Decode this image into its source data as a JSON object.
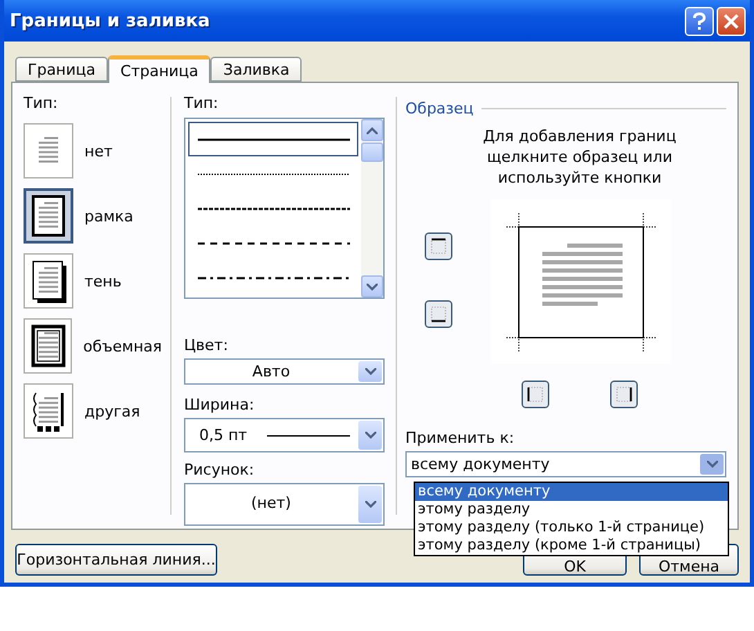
{
  "window": {
    "title": "Границы и заливка"
  },
  "tabs": [
    {
      "label": "Граница",
      "selected": false
    },
    {
      "label": "Страница",
      "selected": true
    },
    {
      "label": "Заливка",
      "selected": false
    }
  ],
  "setting": {
    "label": "Тип:",
    "options": [
      {
        "label": "нет",
        "kind": "none",
        "selected": false
      },
      {
        "label": "рамка",
        "kind": "box",
        "selected": true
      },
      {
        "label": "тень",
        "kind": "shadow",
        "selected": false
      },
      {
        "label": "объемная",
        "kind": "double",
        "selected": false
      },
      {
        "label": "другая",
        "kind": "custom",
        "selected": false
      }
    ]
  },
  "style": {
    "label": "Тип:",
    "lines": [
      {
        "kind": "solid",
        "selected": true
      },
      {
        "kind": "dotted",
        "selected": false
      },
      {
        "kind": "dashed",
        "selected": false
      },
      {
        "kind": "longdash",
        "selected": false
      },
      {
        "kind": "dashdot",
        "selected": false
      }
    ]
  },
  "color": {
    "label": "Цвет:",
    "value": "Авто"
  },
  "width": {
    "label": "Ширина:",
    "value": "0,5 пт"
  },
  "art": {
    "label": "Рисунок:",
    "value": "(нет)"
  },
  "preview": {
    "title": "Образец",
    "hint": "Для добавления границ щелкните образец или используйте кнопки",
    "buttons": [
      {
        "kind": "top"
      },
      {
        "kind": "bottom"
      },
      {
        "kind": "left"
      },
      {
        "kind": "right"
      }
    ]
  },
  "apply_to": {
    "label": "Применить к:",
    "value": "всему документу",
    "expanded": true,
    "options": [
      {
        "label": "всему документу",
        "selected": true
      },
      {
        "label": "этому разделу",
        "selected": false
      },
      {
        "label": "этому разделу (только 1-й странице)",
        "selected": false
      },
      {
        "label": "этому разделу (кроме 1-й страницы)",
        "selected": false
      }
    ]
  },
  "buttons": [
    {
      "label": "Горизонтальная линия..."
    },
    {
      "label": "OK"
    },
    {
      "label": "Отмена"
    }
  ]
}
